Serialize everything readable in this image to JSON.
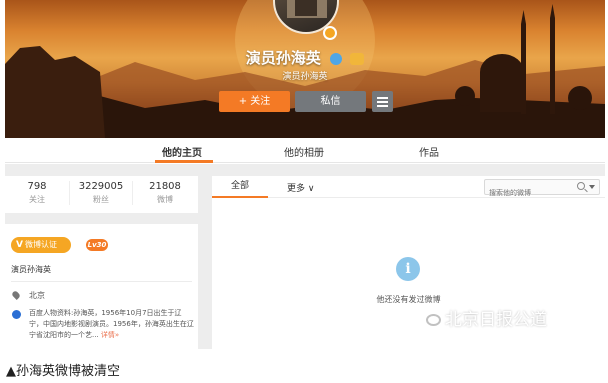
{
  "profile_header": {
    "name": "演员孙海英",
    "subtitle": "演员孙海英",
    "follow_button": "+ 关注",
    "message_button": "私信",
    "colors": {
      "follow": "#f47a25",
      "secondary": "#74787c",
      "verify": "#f5a623"
    }
  },
  "tabs": [
    {
      "label": "他的主页",
      "active": true
    },
    {
      "label": "他的相册",
      "active": false
    },
    {
      "label": "作品",
      "active": false
    }
  ],
  "stats": [
    {
      "value": "798",
      "label": "关注"
    },
    {
      "value": "3229005",
      "label": "粉丝"
    },
    {
      "value": "21808",
      "label": "微博"
    }
  ],
  "profile_card": {
    "verify_badge": "微博认证",
    "level_badge": "Lv30",
    "title": "演员孙海英",
    "location": "北京",
    "bio": "百度人物资料:孙海英，1956年10月7日出生于辽宁，中国内地影视剧演员。1956年，孙海英出生在辽宁省沈阳市的一个艺...",
    "bio_more": "详情»"
  },
  "feed": {
    "tab_all": "全部",
    "tab_more": "更多 ∨",
    "search_placeholder": "搜索他的微博",
    "empty_message": "他还没有发过微博"
  },
  "watermark": "北京日报公道",
  "caption": "▲孙海英微博被清空"
}
